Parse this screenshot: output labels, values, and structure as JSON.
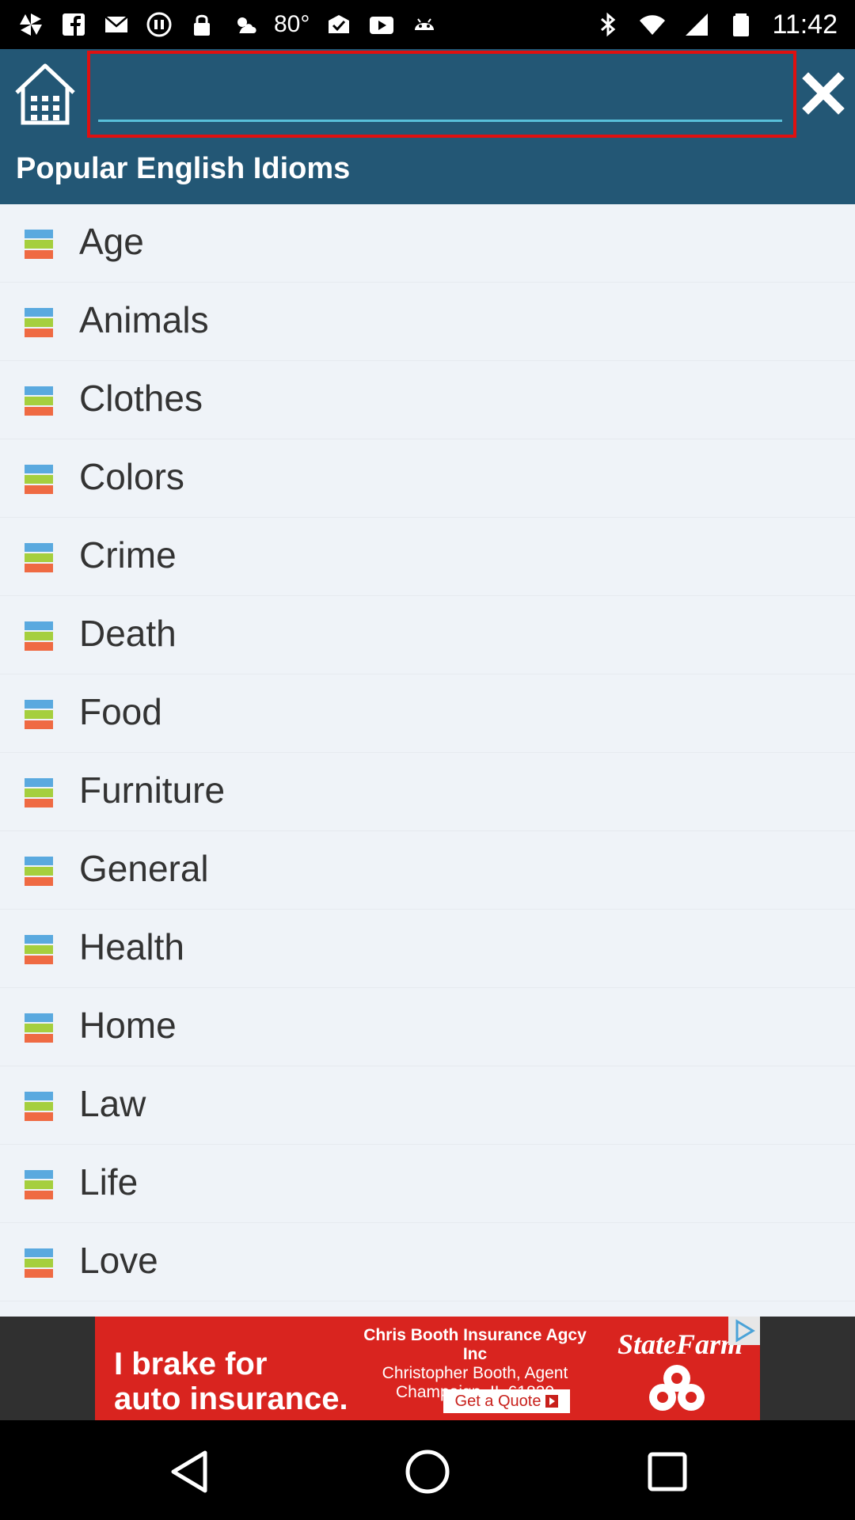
{
  "status_bar": {
    "time": "11:42",
    "temperature": "80°",
    "left_icons": [
      "pinwheel-icon",
      "facebook-icon",
      "mail-icon",
      "media-icon",
      "lock-icon",
      "weather-icon",
      "checkmark-icon",
      "youtube-icon",
      "android-icon"
    ],
    "right_icons": [
      "bluetooth-icon",
      "wifi-icon",
      "signal-icon",
      "battery-icon"
    ]
  },
  "header": {
    "home_icon": "home-icon",
    "search": {
      "value": "",
      "placeholder": ""
    },
    "close_icon": "close-icon",
    "title": "Popular English Idioms",
    "background": "#235775"
  },
  "list": {
    "items": [
      {
        "label": "Age",
        "icon": "list-stack-icon"
      },
      {
        "label": "Animals",
        "icon": "list-stack-icon"
      },
      {
        "label": "Clothes",
        "icon": "list-stack-icon"
      },
      {
        "label": "Colors",
        "icon": "list-stack-icon"
      },
      {
        "label": "Crime",
        "icon": "list-stack-icon"
      },
      {
        "label": "Death",
        "icon": "list-stack-icon"
      },
      {
        "label": "Food",
        "icon": "list-stack-icon"
      },
      {
        "label": "Furniture",
        "icon": "list-stack-icon"
      },
      {
        "label": "General",
        "icon": "list-stack-icon"
      },
      {
        "label": "Health",
        "icon": "list-stack-icon"
      },
      {
        "label": "Home",
        "icon": "list-stack-icon"
      },
      {
        "label": "Law",
        "icon": "list-stack-icon"
      },
      {
        "label": "Life",
        "icon": "list-stack-icon"
      },
      {
        "label": "Love",
        "icon": "list-stack-icon"
      }
    ]
  },
  "ad": {
    "headline_line1": "I brake for",
    "headline_line2": "auto insurance.",
    "agency": "Chris Booth Insurance Agcy Inc",
    "agent": "Christopher Booth, Agent",
    "location": "Champaign, IL 61820",
    "cta": "Get a Quote",
    "brand": "StateFarm",
    "background": "#d9241f"
  },
  "nav_bar": {
    "icons": [
      "back-icon",
      "home-circle-icon",
      "recents-icon"
    ]
  }
}
